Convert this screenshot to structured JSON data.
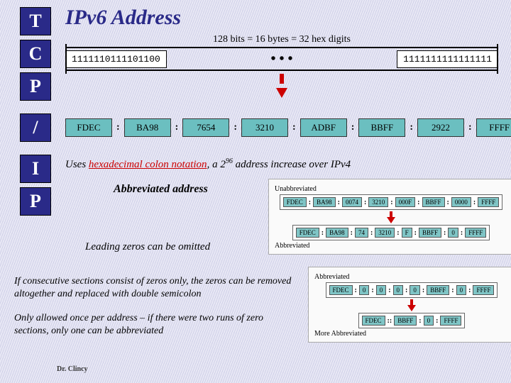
{
  "title": "IPv6 Address",
  "sidebar": {
    "t": "T",
    "c": "C",
    "p": "P",
    "slash": "/",
    "i": "I",
    "p2": "P"
  },
  "bits": {
    "caption": "128 bits = 16 bytes = 32 hex digits",
    "left_seg": "1111110111101100",
    "dots": "• • •",
    "right_seg": "1111111111111111"
  },
  "hex_groups": [
    "FDEC",
    "BA98",
    "7654",
    "3210",
    "ADBF",
    "BBFF",
    "2922",
    "FFFF"
  ],
  "colon": ":",
  "note_uses": {
    "pre": "Uses ",
    "hl": "hexadecimal colon notation",
    "mid": ", a 2",
    "sup": "96",
    "post": " address increase over IPv4"
  },
  "abbrev_heading": "Abbreviated address",
  "panel1": {
    "label_top": "Unabbreviated",
    "row_top": [
      "FDEC",
      "BA98",
      "0074",
      "3210",
      "000F",
      "BBFF",
      "0000",
      "FFFF"
    ],
    "label_bottom": "Abbreviated",
    "row_bottom": [
      "FDEC",
      "BA98",
      "74",
      "3210",
      "F",
      "BBFF",
      "0",
      "FFFF"
    ]
  },
  "leading_zeros": "Leading zeros can be omitted",
  "para1": "If consecutive sections consist of zeros only, the zeros can be removed altogether and replaced with double semicolon",
  "para2": "Only allowed once per address – if there were two runs of zero sections, only one can be abbreviated",
  "panel2": {
    "label_top": "Abbreviated",
    "row_top": [
      "FDEC",
      "0",
      "0",
      "0",
      "0",
      "BBFF",
      "0",
      "FFFF"
    ],
    "label_bottom": "More Abbreviated",
    "row_bottom_left": "FDEC",
    "dcolon": "::",
    "row_bottom_mid": "BBFF",
    "row_bottom_mid2": "0",
    "row_bottom_right": "FFFF"
  },
  "footer": "Dr. Clincy"
}
